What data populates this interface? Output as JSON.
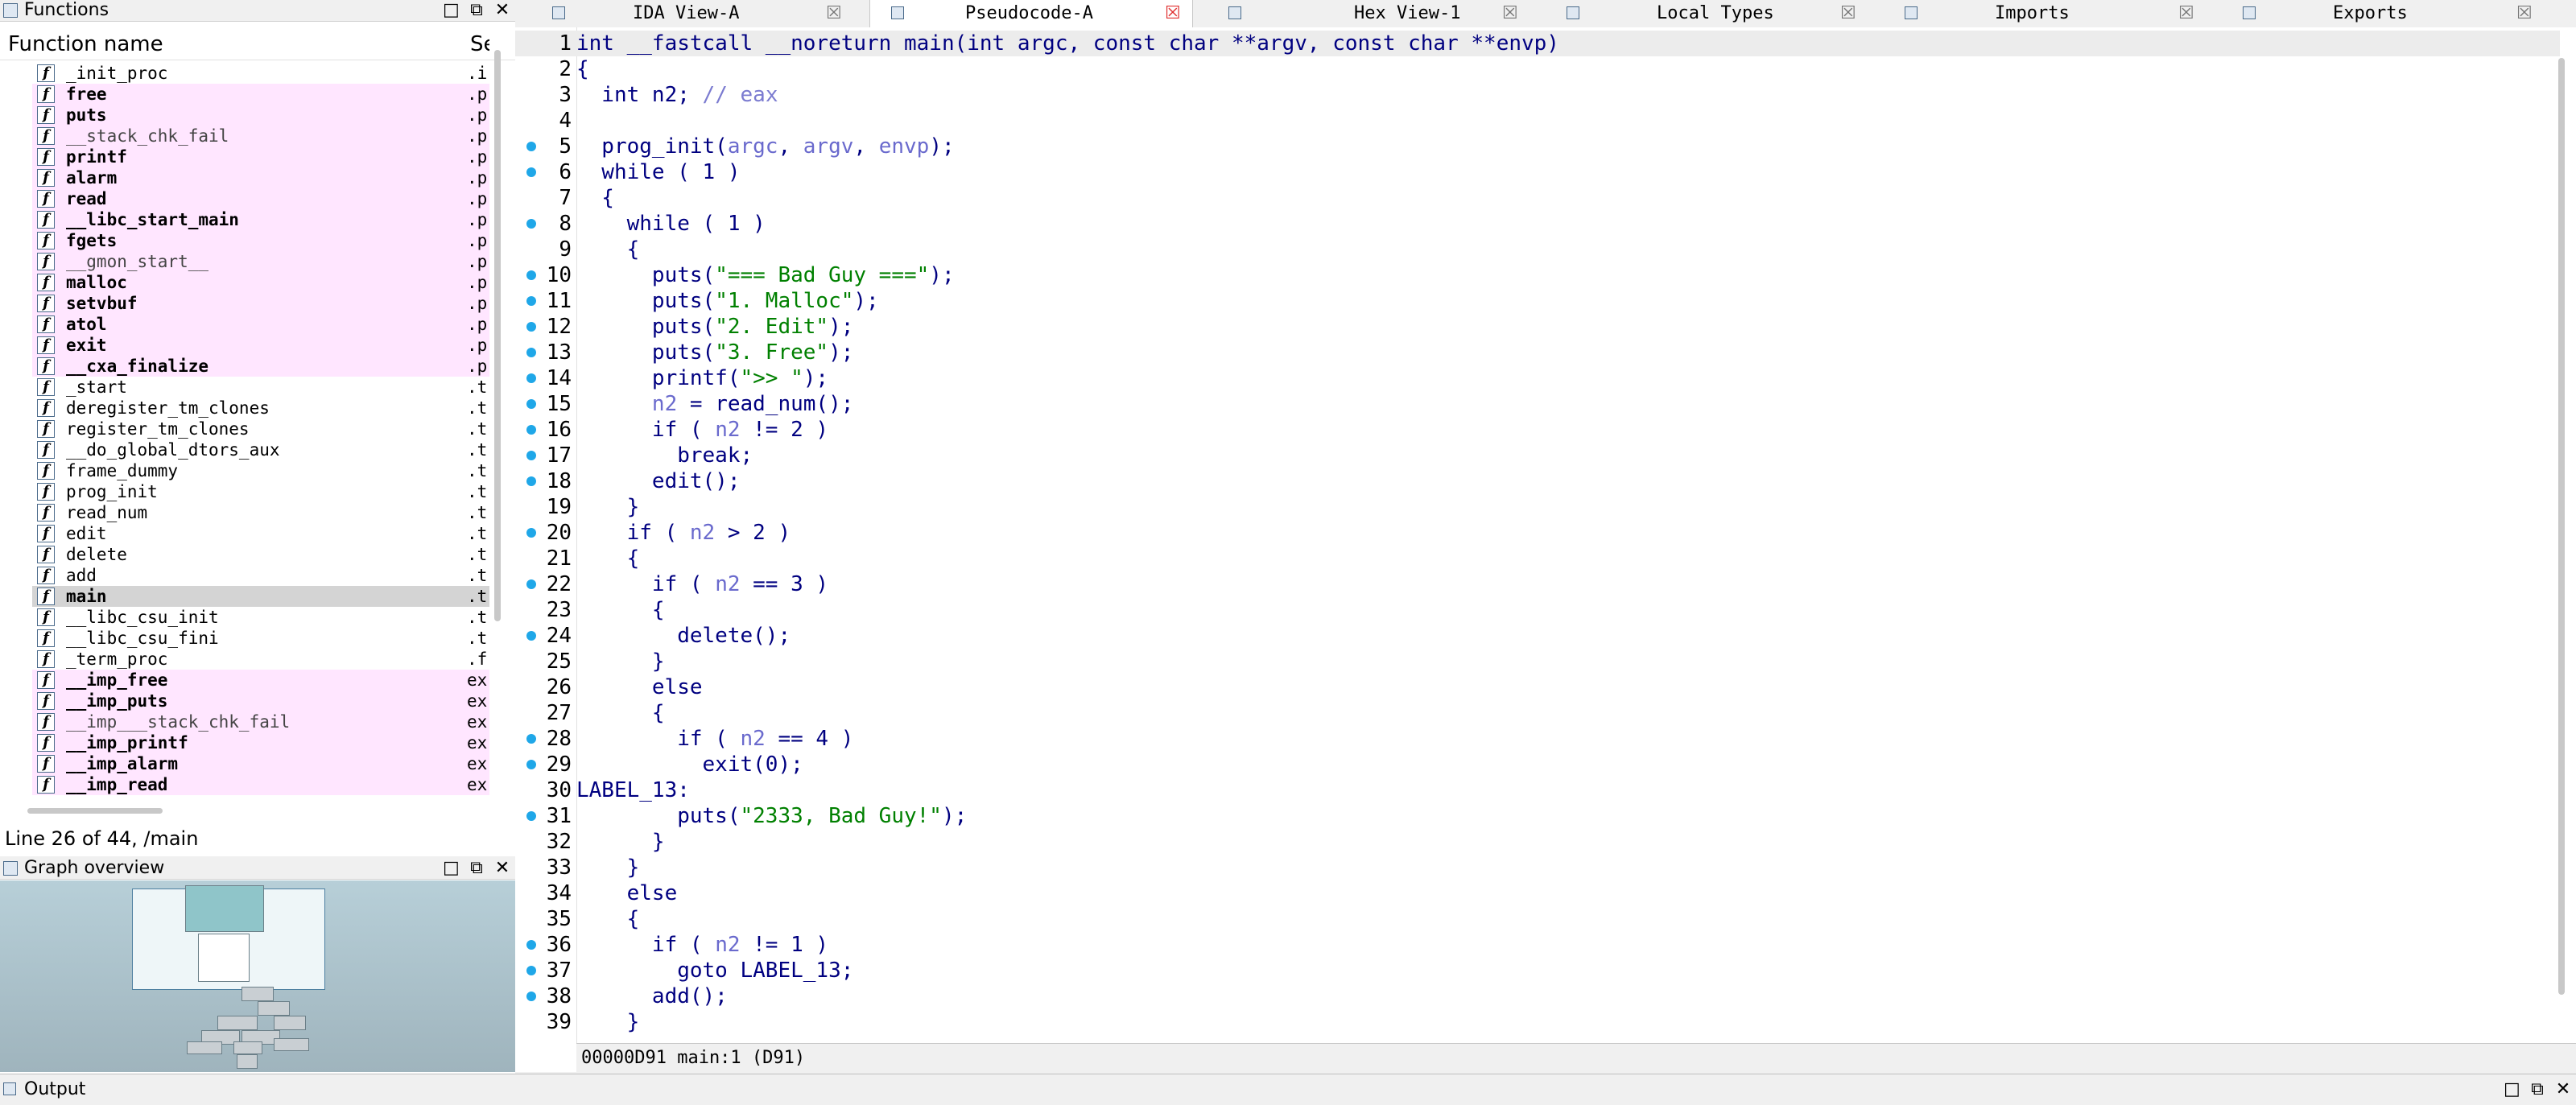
{
  "functions_panel": {
    "title": "Functions",
    "col_name": "Function name",
    "col_segment": "Se",
    "status": "Line 26 of 44, /main",
    "rows": [
      {
        "name": "_init_proc",
        "seg": ".i",
        "style": "normal"
      },
      {
        "name": "free",
        "seg": ".p",
        "style": "ext"
      },
      {
        "name": "puts",
        "seg": ".p",
        "style": "ext"
      },
      {
        "name": "__stack_chk_fail",
        "seg": ".p",
        "style": "ext-light"
      },
      {
        "name": "printf",
        "seg": ".p",
        "style": "ext"
      },
      {
        "name": "alarm",
        "seg": ".p",
        "style": "ext"
      },
      {
        "name": "read",
        "seg": ".p",
        "style": "ext"
      },
      {
        "name": "__libc_start_main",
        "seg": ".p",
        "style": "ext"
      },
      {
        "name": "fgets",
        "seg": ".p",
        "style": "ext"
      },
      {
        "name": "__gmon_start__",
        "seg": ".p",
        "style": "ext-light"
      },
      {
        "name": "malloc",
        "seg": ".p",
        "style": "ext"
      },
      {
        "name": "setvbuf",
        "seg": ".p",
        "style": "ext"
      },
      {
        "name": "atol",
        "seg": ".p",
        "style": "ext"
      },
      {
        "name": "exit",
        "seg": ".p",
        "style": "ext"
      },
      {
        "name": "__cxa_finalize",
        "seg": ".p",
        "style": "ext"
      },
      {
        "name": "_start",
        "seg": ".t",
        "style": "normal"
      },
      {
        "name": "deregister_tm_clones",
        "seg": ".t",
        "style": "normal"
      },
      {
        "name": "register_tm_clones",
        "seg": ".t",
        "style": "normal"
      },
      {
        "name": "__do_global_dtors_aux",
        "seg": ".t",
        "style": "normal"
      },
      {
        "name": "frame_dummy",
        "seg": ".t",
        "style": "normal"
      },
      {
        "name": "prog_init",
        "seg": ".t",
        "style": "normal"
      },
      {
        "name": "read_num",
        "seg": ".t",
        "style": "normal"
      },
      {
        "name": "edit",
        "seg": ".t",
        "style": "normal"
      },
      {
        "name": "delete",
        "seg": ".t",
        "style": "normal"
      },
      {
        "name": "add",
        "seg": ".t",
        "style": "normal"
      },
      {
        "name": "main",
        "seg": ".t",
        "style": "selected"
      },
      {
        "name": "__libc_csu_init",
        "seg": ".t",
        "style": "normal"
      },
      {
        "name": "__libc_csu_fini",
        "seg": ".t",
        "style": "normal"
      },
      {
        "name": "_term_proc",
        "seg": ".f",
        "style": "normal"
      },
      {
        "name": "__imp_free",
        "seg": "ex",
        "style": "ext"
      },
      {
        "name": "__imp_puts",
        "seg": "ex",
        "style": "ext"
      },
      {
        "name": "__imp___stack_chk_fail",
        "seg": "ex",
        "style": "ext-light"
      },
      {
        "name": "__imp_printf",
        "seg": "ex",
        "style": "ext"
      },
      {
        "name": "__imp_alarm",
        "seg": "ex",
        "style": "ext"
      },
      {
        "name": "__imp_read",
        "seg": "ex",
        "style": "ext"
      }
    ]
  },
  "graph_panel": {
    "title": "Graph overview"
  },
  "tabs": [
    {
      "label": "IDA View-A",
      "active": false
    },
    {
      "label": "Pseudocode-A",
      "active": true
    },
    {
      "label": "Hex View-1",
      "active": false
    },
    {
      "label": "Local Types",
      "active": false
    },
    {
      "label": "Imports",
      "active": false
    },
    {
      "label": "Exports",
      "active": false
    }
  ],
  "code": {
    "status": "00000D91 main:1 (D91)",
    "lines": [
      {
        "n": "1",
        "dot": false,
        "hl": true,
        "parts": [
          [
            "k",
            "int __fastcall __noreturn main(int argc, const char **argv, const char **envp)"
          ]
        ]
      },
      {
        "n": "2",
        "dot": false,
        "parts": [
          [
            "k",
            "{"
          ]
        ]
      },
      {
        "n": "3",
        "dot": false,
        "parts": [
          [
            "k",
            "  int n2; "
          ],
          [
            "c",
            "// eax"
          ]
        ]
      },
      {
        "n": "4",
        "dot": false,
        "parts": []
      },
      {
        "n": "5",
        "dot": true,
        "parts": [
          [
            "k",
            "  prog_init("
          ],
          [
            "v",
            "argc"
          ],
          [
            "k",
            ", "
          ],
          [
            "v",
            "argv"
          ],
          [
            "k",
            ", "
          ],
          [
            "v",
            "envp"
          ],
          [
            "k",
            ");"
          ]
        ]
      },
      {
        "n": "6",
        "dot": true,
        "parts": [
          [
            "k",
            "  while ( 1 )"
          ]
        ]
      },
      {
        "n": "7",
        "dot": false,
        "parts": [
          [
            "k",
            "  {"
          ]
        ]
      },
      {
        "n": "8",
        "dot": true,
        "parts": [
          [
            "k",
            "    while ( 1 )"
          ]
        ]
      },
      {
        "n": "9",
        "dot": false,
        "parts": [
          [
            "k",
            "    {"
          ]
        ]
      },
      {
        "n": "10",
        "dot": true,
        "parts": [
          [
            "k",
            "      puts("
          ],
          [
            "s",
            "\"=== Bad Guy ===\""
          ],
          [
            "k",
            ");"
          ]
        ]
      },
      {
        "n": "11",
        "dot": true,
        "parts": [
          [
            "k",
            "      puts("
          ],
          [
            "s",
            "\"1. Malloc\""
          ],
          [
            "k",
            ");"
          ]
        ]
      },
      {
        "n": "12",
        "dot": true,
        "parts": [
          [
            "k",
            "      puts("
          ],
          [
            "s",
            "\"2. Edit\""
          ],
          [
            "k",
            ");"
          ]
        ]
      },
      {
        "n": "13",
        "dot": true,
        "parts": [
          [
            "k",
            "      puts("
          ],
          [
            "s",
            "\"3. Free\""
          ],
          [
            "k",
            ");"
          ]
        ]
      },
      {
        "n": "14",
        "dot": true,
        "parts": [
          [
            "k",
            "      printf("
          ],
          [
            "s",
            "\">> \""
          ],
          [
            "k",
            ");"
          ]
        ]
      },
      {
        "n": "15",
        "dot": true,
        "parts": [
          [
            "k",
            "      "
          ],
          [
            "v",
            "n2"
          ],
          [
            "k",
            " = read_num();"
          ]
        ]
      },
      {
        "n": "16",
        "dot": true,
        "parts": [
          [
            "k",
            "      if ( "
          ],
          [
            "v",
            "n2"
          ],
          [
            "k",
            " != 2 )"
          ]
        ]
      },
      {
        "n": "17",
        "dot": true,
        "parts": [
          [
            "k",
            "        break;"
          ]
        ]
      },
      {
        "n": "18",
        "dot": true,
        "parts": [
          [
            "k",
            "      edit();"
          ]
        ]
      },
      {
        "n": "19",
        "dot": false,
        "parts": [
          [
            "k",
            "    }"
          ]
        ]
      },
      {
        "n": "20",
        "dot": true,
        "parts": [
          [
            "k",
            "    if ( "
          ],
          [
            "v",
            "n2"
          ],
          [
            "k",
            " > 2 )"
          ]
        ]
      },
      {
        "n": "21",
        "dot": false,
        "parts": [
          [
            "k",
            "    {"
          ]
        ]
      },
      {
        "n": "22",
        "dot": true,
        "parts": [
          [
            "k",
            "      if ( "
          ],
          [
            "v",
            "n2"
          ],
          [
            "k",
            " == 3 )"
          ]
        ]
      },
      {
        "n": "23",
        "dot": false,
        "parts": [
          [
            "k",
            "      {"
          ]
        ]
      },
      {
        "n": "24",
        "dot": true,
        "parts": [
          [
            "k",
            "        delete();"
          ]
        ]
      },
      {
        "n": "25",
        "dot": false,
        "parts": [
          [
            "k",
            "      }"
          ]
        ]
      },
      {
        "n": "26",
        "dot": false,
        "parts": [
          [
            "k",
            "      else"
          ]
        ]
      },
      {
        "n": "27",
        "dot": false,
        "parts": [
          [
            "k",
            "      {"
          ]
        ]
      },
      {
        "n": "28",
        "dot": true,
        "parts": [
          [
            "k",
            "        if ( "
          ],
          [
            "v",
            "n2"
          ],
          [
            "k",
            " == 4 )"
          ]
        ]
      },
      {
        "n": "29",
        "dot": true,
        "parts": [
          [
            "k",
            "          exit(0);"
          ]
        ]
      },
      {
        "n": "30",
        "dot": false,
        "parts": [
          [
            "k",
            "LABEL_13:"
          ]
        ]
      },
      {
        "n": "31",
        "dot": true,
        "parts": [
          [
            "k",
            "        puts("
          ],
          [
            "s",
            "\"2333, Bad Guy!\""
          ],
          [
            "k",
            ");"
          ]
        ]
      },
      {
        "n": "32",
        "dot": false,
        "parts": [
          [
            "k",
            "      }"
          ]
        ]
      },
      {
        "n": "33",
        "dot": false,
        "parts": [
          [
            "k",
            "    }"
          ]
        ]
      },
      {
        "n": "34",
        "dot": false,
        "parts": [
          [
            "k",
            "    else"
          ]
        ]
      },
      {
        "n": "35",
        "dot": false,
        "parts": [
          [
            "k",
            "    {"
          ]
        ]
      },
      {
        "n": "36",
        "dot": true,
        "parts": [
          [
            "k",
            "      if ( "
          ],
          [
            "v",
            "n2"
          ],
          [
            "k",
            " != 1 )"
          ]
        ]
      },
      {
        "n": "37",
        "dot": true,
        "parts": [
          [
            "k",
            "        goto LABEL_13;"
          ]
        ]
      },
      {
        "n": "38",
        "dot": true,
        "parts": [
          [
            "k",
            "      add();"
          ]
        ]
      },
      {
        "n": "39",
        "dot": false,
        "parts": [
          [
            "k",
            "    }"
          ]
        ]
      }
    ]
  },
  "output_panel": {
    "title": "Output"
  },
  "colors": {
    "ext_bg": "#ffe6ff",
    "bp_dot": "#1fa7e8",
    "keyword": "#000080",
    "string": "#008000",
    "comment": "#7b7bd0"
  },
  "icons": {
    "function": "function-icon",
    "breakpoint": "breakpoint-dot-icon"
  }
}
